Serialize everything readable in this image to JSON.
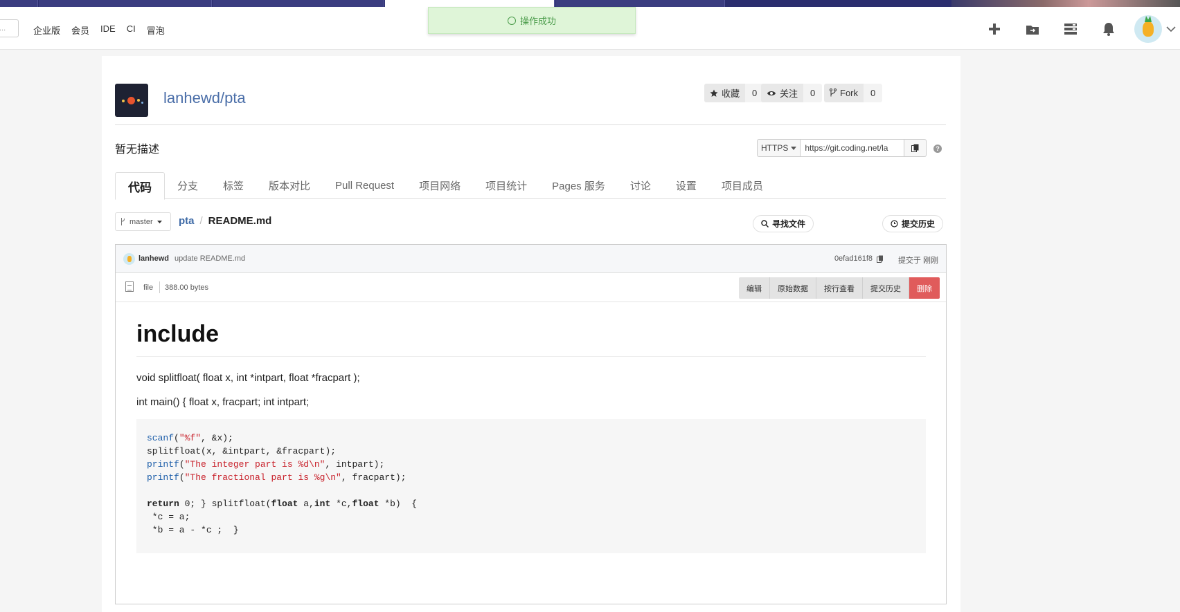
{
  "topnav": {
    "search_placeholder": "...",
    "links": [
      "企业版",
      "会员",
      "IDE",
      "CI",
      "冒泡"
    ]
  },
  "toast": {
    "message": "操作成功",
    "color": "#4a9b4a"
  },
  "icons": {
    "add": "plus-icon",
    "folder": "folder-icon",
    "tasks": "list-icon",
    "notify": "bell-icon",
    "avatar": "pineapple-avatar"
  },
  "repo": {
    "name": "lanhewd/pta",
    "description": "暂无描述",
    "stats": [
      {
        "label": "收藏",
        "count": "0",
        "icon": "star-icon"
      },
      {
        "label": "关注",
        "count": "0",
        "icon": "eye-icon"
      },
      {
        "label": "Fork",
        "count": "0",
        "icon": "fork-icon"
      }
    ],
    "clone": {
      "protocol": "HTTPS",
      "url": "https://git.coding.net/la"
    }
  },
  "tabs": [
    "代码",
    "分支",
    "标签",
    "版本对比",
    "Pull Request",
    "项目网络",
    "项目统计",
    "Pages 服务",
    "讨论",
    "设置",
    "项目成员"
  ],
  "file_nav": {
    "branch": "master",
    "root": "pta",
    "separator": "/",
    "file": "README.md",
    "find_file": "寻找文件",
    "history": "提交历史"
  },
  "commit": {
    "author": "lanhewd",
    "message": "update README.md",
    "sha": "0efad161f8",
    "time": "提交于 刚刚"
  },
  "fileinfo": {
    "kind": "file",
    "size": "388.00 bytes",
    "actions": [
      "编辑",
      "原始数据",
      "按行查看",
      "提交历史",
      "删除"
    ]
  },
  "readme": {
    "heading": "include",
    "para1": "void splitfloat( float x, int *intpart, float *fracpart );",
    "para2": "int main() { float x, fracpart; int intpart;",
    "code": {
      "l1_fn": "scanf",
      "l1_a": "(",
      "l1_str": "\"%f\"",
      "l1_b": ", &x);",
      "l2": "splitfloat(x, &intpart, &fracpart);",
      "l3_fn": "printf",
      "l3_a": "(",
      "l3_str": "\"The integer part is %d\\n\"",
      "l3_b": ", intpart);",
      "l4_fn": "printf",
      "l4_a": "(",
      "l4_str": "\"The fractional part is %g\\n\"",
      "l4_b": ", fracpart);",
      "l6_kw1": "return",
      "l6_a": " 0; } splitfloat(",
      "l6_kw2": "float",
      "l6_b": " a,",
      "l6_kw3": "int",
      "l6_c": " *c,",
      "l6_kw4": "float",
      "l6_d": " *b)  {",
      "l7": " *c = a;",
      "l8": " *b = a - *c ;  }"
    }
  }
}
